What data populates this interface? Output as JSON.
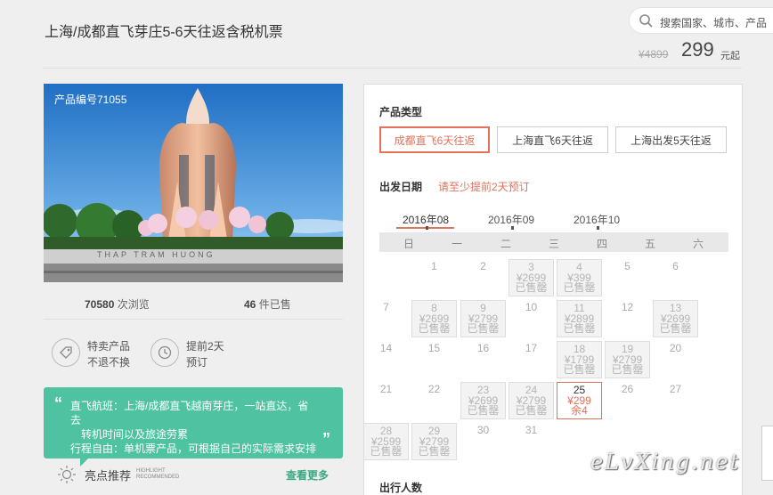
{
  "header": {
    "title": "上海/成都直飞芽庄5-6天往返含税机票",
    "search_placeholder": "搜索国家、城市、产品",
    "price_old": "¥4899",
    "price_now": "299",
    "price_unit": "元起"
  },
  "product": {
    "product_no": "产品编号71055",
    "photo_sign": "THAP TRAM HUONG",
    "views_num": "70580",
    "views_label": " 次浏览",
    "sold_num": "46",
    "sold_label": " 件已售",
    "features": [
      {
        "line1": "特卖产品",
        "line2": "不退不换",
        "icon": "tag-icon"
      },
      {
        "line1": "提前2天",
        "line2": "预订",
        "icon": "clock-icon"
      }
    ],
    "bubble_line1": "直飞航班：上海/成都直飞越南芽庄，一站直达，省去",
    "bubble_line2": "转机时间以及旅途劳累",
    "bubble_line3": "行程自由：单机票产品，可根据自己的实际需求安排",
    "highlight_label": "亮点推荐",
    "highlight_en1": "HIGHLIGHT",
    "highlight_en2": "RECOMMENDED",
    "more_link": "查看更多"
  },
  "booking": {
    "type_heading": "产品类型",
    "types": [
      "成都直飞6天往返",
      "上海直飞6天往返",
      "上海出发5天往返"
    ],
    "date_heading": "出发日期",
    "date_hint": "请至少提前2天预订",
    "months": [
      "2016年08",
      "2016年09",
      "2016年10"
    ],
    "weekdays": [
      "日",
      "一",
      "二",
      "三",
      "四",
      "五",
      "六"
    ],
    "people_heading": "出行人数"
  },
  "calendar": [
    {
      "day": "1"
    },
    {
      "day": "2"
    },
    {
      "day": "3",
      "price": "¥2699",
      "status": "已售罄"
    },
    {
      "day": "4",
      "price": "¥399",
      "status": "已售罄"
    },
    {
      "day": "5"
    },
    {
      "day": "6"
    },
    {
      "day": "7"
    },
    {
      "day": "8",
      "price": "¥2699",
      "status": "已售罄"
    },
    {
      "day": "9",
      "price": "¥2799",
      "status": "已售罄"
    },
    {
      "day": "10"
    },
    {
      "day": "11",
      "price": "¥2899",
      "status": "已售罄"
    },
    {
      "day": "12"
    },
    {
      "day": "13",
      "price": "¥2699",
      "status": "已售罄"
    },
    {
      "day": "14"
    },
    {
      "day": "15"
    },
    {
      "day": "16"
    },
    {
      "day": "17"
    },
    {
      "day": "18",
      "price": "¥1799",
      "status": "已售罄"
    },
    {
      "day": "19",
      "price": "¥2799",
      "status": "已售罄"
    },
    {
      "day": "20"
    },
    {
      "day": "21"
    },
    {
      "day": "22"
    },
    {
      "day": "23",
      "price": "¥2699",
      "status": "已售罄"
    },
    {
      "day": "24",
      "price": "¥2799",
      "status": "已售罄"
    },
    {
      "day": "25",
      "price": "¥299",
      "status": "余4"
    },
    {
      "day": "26"
    },
    {
      "day": "27"
    },
    {
      "day": "28",
      "price": "¥2599",
      "status": "已售罄"
    },
    {
      "day": "29",
      "price": "¥2799",
      "status": "已售罄"
    },
    {
      "day": "30"
    },
    {
      "day": "31"
    }
  ],
  "watermark": "eLvXing.net",
  "colors": {
    "accent": "#e2725a",
    "green": "#4fc3a1",
    "link": "#3aa884"
  }
}
